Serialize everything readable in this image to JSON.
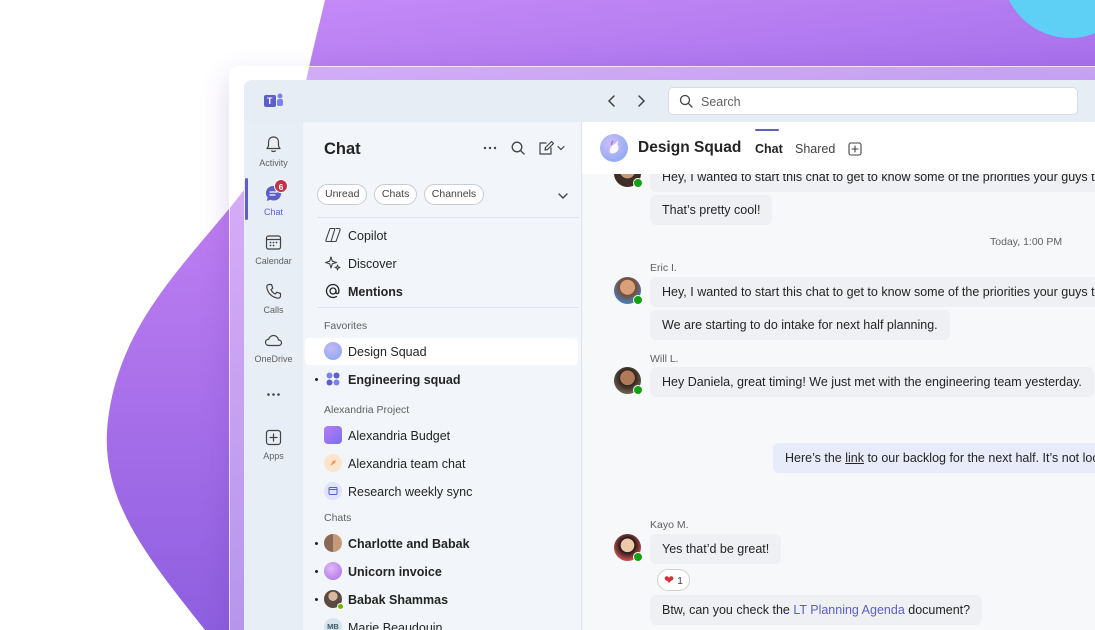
{
  "titlebar": {
    "back_icon": "chevron-left-icon",
    "forward_icon": "chevron-right-icon",
    "search_placeholder": "Search"
  },
  "rail": {
    "items": [
      {
        "label": "Activity",
        "icon": "bell-icon"
      },
      {
        "label": "Chat",
        "icon": "chat-icon",
        "badge": "6"
      },
      {
        "label": "Calendar",
        "icon": "calendar-icon"
      },
      {
        "label": "Calls",
        "icon": "phone-icon"
      },
      {
        "label": "OneDrive",
        "icon": "cloud-icon"
      },
      {
        "label": "...",
        "icon": "more-icon"
      },
      {
        "label": "Apps",
        "icon": "add-apps-icon"
      }
    ]
  },
  "chat_list": {
    "title": "Chat",
    "filters": [
      "Unread",
      "Chats",
      "Channels"
    ],
    "pinned": [
      {
        "label": "Copilot",
        "icon": "copilot-icon"
      },
      {
        "label": "Discover",
        "icon": "sparkle-icon"
      },
      {
        "label": "Mentions",
        "icon": "at-icon"
      }
    ],
    "favorites_label": "Favorites",
    "favorites": [
      {
        "label": "Design Squad"
      },
      {
        "label": "Engineering squad"
      }
    ],
    "project_label": "Alexandria Project",
    "project": [
      {
        "label": "Alexandria Budget"
      },
      {
        "label": "Alexandria team chat"
      },
      {
        "label": "Research weekly sync"
      }
    ],
    "chats_label": "Chats",
    "chats": [
      {
        "label": "Charlotte and Babak"
      },
      {
        "label": "Unicorn invoice"
      },
      {
        "label": "Babak Shammas"
      },
      {
        "label": "Marie Beaudouin",
        "initials": "MB"
      }
    ]
  },
  "conversation": {
    "title": "Design Squad",
    "tabs": [
      "Chat",
      "Shared"
    ],
    "messages": {
      "m1": "Hey, I wanted to start this chat to get to know some of the priorities your guys te",
      "m2": "That’s pretty cool!",
      "timestamp": "Today, 1:00 PM",
      "eric_name": "Eric I.",
      "m3": "Hey, I wanted to start this chat to get to know some of the priorities your guys te",
      "m4": "We are starting to do intake for next half planning.",
      "will_name": "Will L.",
      "m5": "Hey Daniela, great timing! We just met with the engineering team yesterday.",
      "mine_pre": "Here’s the ",
      "mine_link": "link",
      "mine_post": " to our backlog for the next half. It’s not loo",
      "kayo_name": "Kayo M.",
      "m6": "Yes that’d be great!",
      "reaction_count": "1",
      "m7_pre": "Btw, can you check the ",
      "m7_link": "LT Planning Agenda",
      "m7_post": " document?"
    }
  },
  "colors": {
    "accent": "#5b5fc7",
    "badge": "#c4314b",
    "presence": "#13a10e",
    "background_purple": "#b57cf0"
  }
}
